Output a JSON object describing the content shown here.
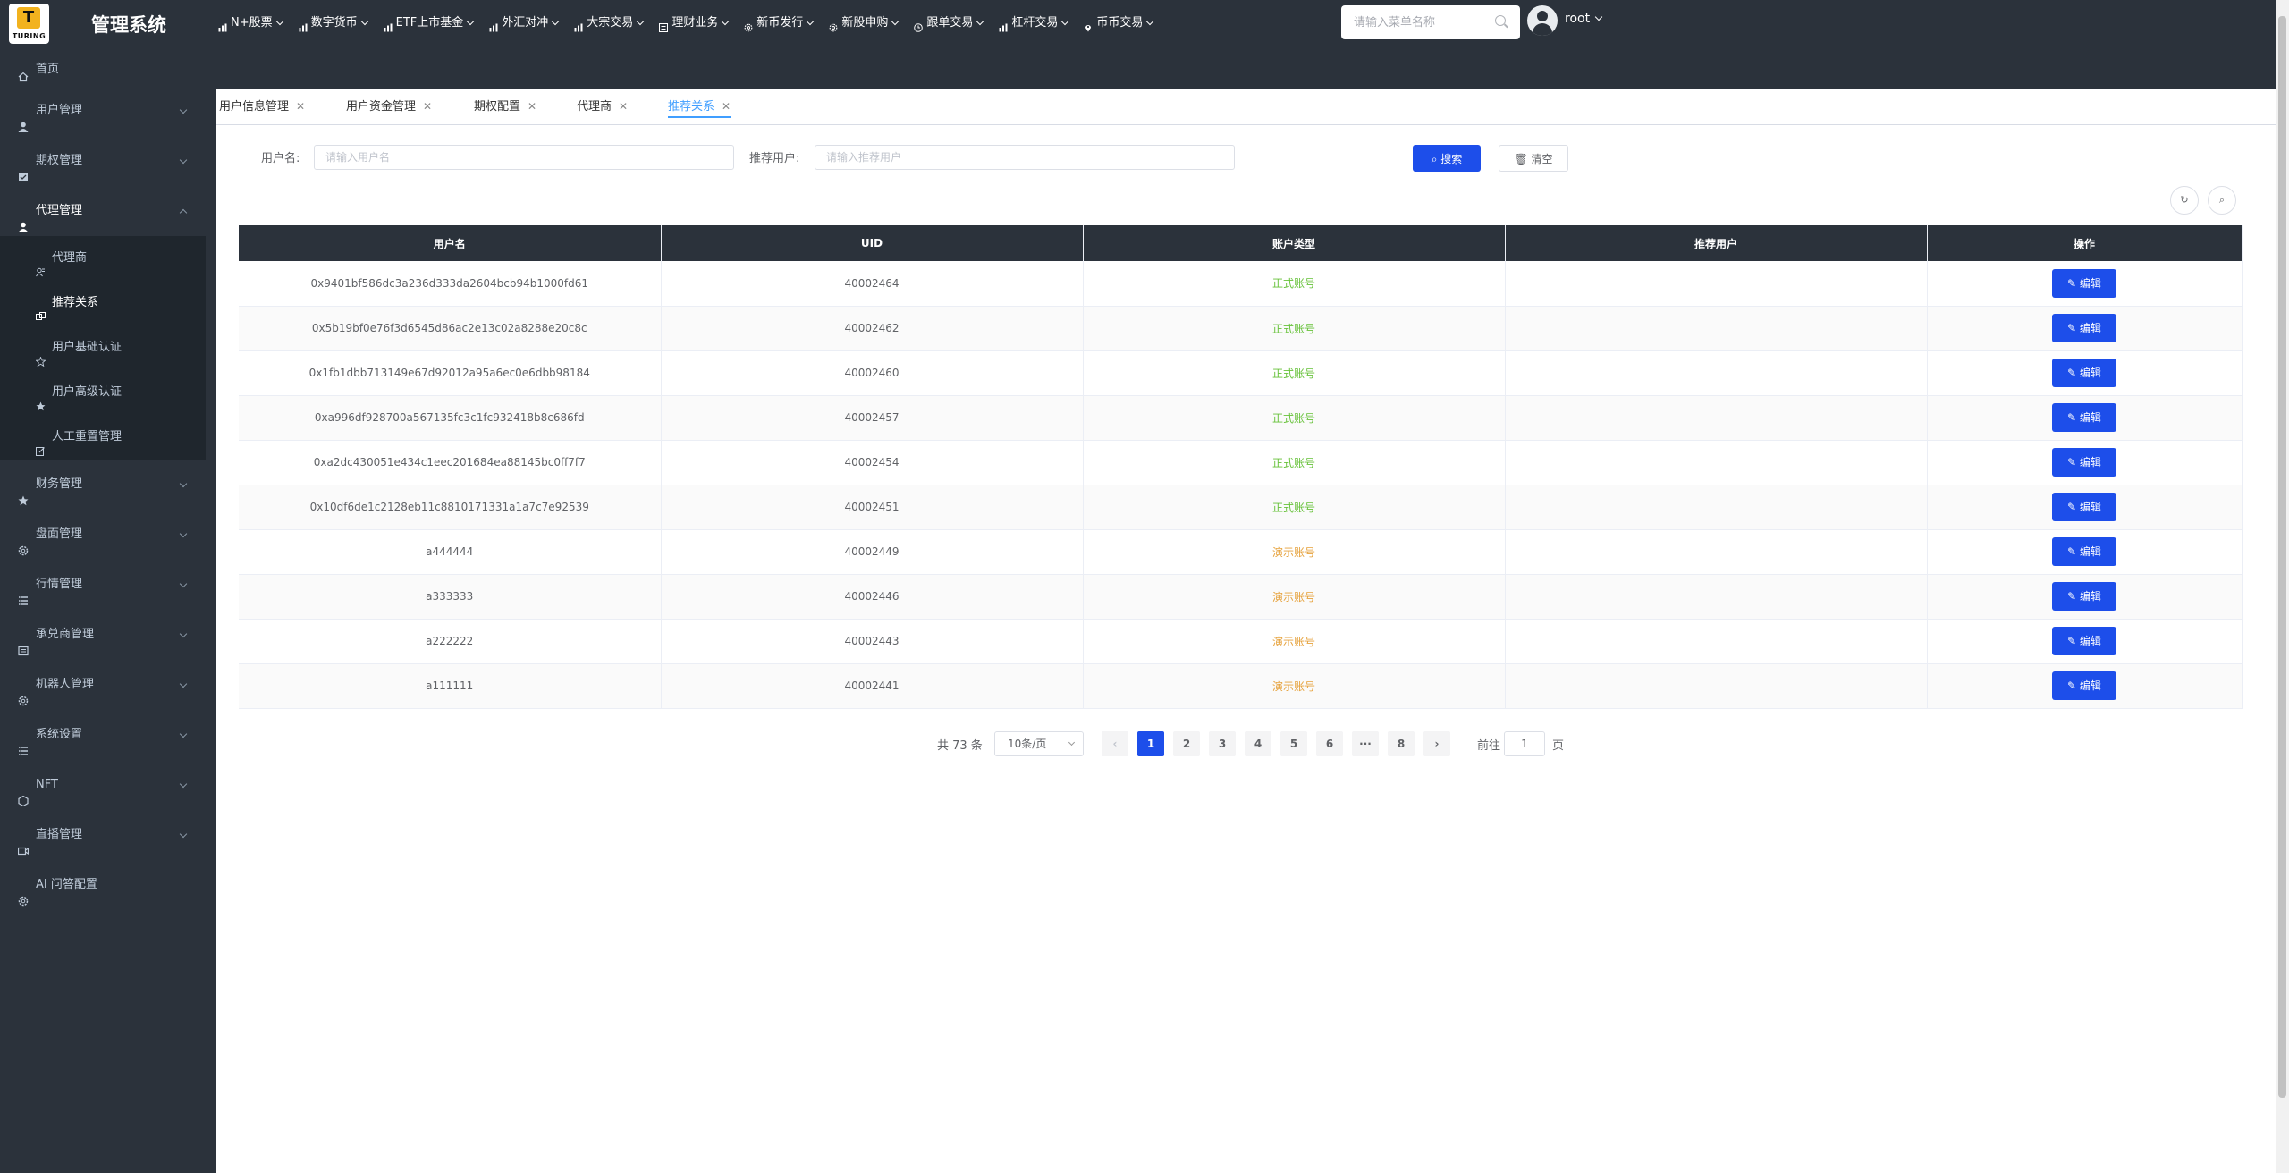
{
  "brand": {
    "logo_text": "TURING",
    "app_title": "管理系统"
  },
  "topnav": [
    {
      "label": "N+股票",
      "icon": "chart-bars-icon"
    },
    {
      "label": "数字货币",
      "icon": "chart-bars-icon"
    },
    {
      "label": "ETF上市基金",
      "icon": "chart-bars-icon"
    },
    {
      "label": "外汇对冲",
      "icon": "chart-bars-icon"
    },
    {
      "label": "大宗交易",
      "icon": "chart-bars-icon"
    },
    {
      "label": "理财业务",
      "icon": "list-icon"
    },
    {
      "label": "新币发行",
      "icon": "gear-icon"
    },
    {
      "label": "新股申购",
      "icon": "gear-icon"
    },
    {
      "label": "跟单交易",
      "icon": "clock-icon"
    },
    {
      "label": "杠杆交易",
      "icon": "chart-bars-icon"
    },
    {
      "label": "币币交易",
      "icon": "location-icon"
    }
  ],
  "header": {
    "search_placeholder": "请输入菜单名称",
    "user_name": "root"
  },
  "sidebar": {
    "items": [
      {
        "label": "首页",
        "icon": "home-icon"
      },
      {
        "label": "用户管理",
        "icon": "user-icon"
      },
      {
        "label": "期权管理",
        "icon": "checkbox-icon"
      },
      {
        "label": "代理管理",
        "icon": "user-icon"
      },
      {
        "label": "财务管理",
        "icon": "star-icon"
      },
      {
        "label": "盘面管理",
        "icon": "gear-icon"
      },
      {
        "label": "行情管理",
        "icon": "list-icon"
      },
      {
        "label": "承兑商管理",
        "icon": "box-icon"
      },
      {
        "label": "机器人管理",
        "icon": "gear-icon"
      },
      {
        "label": "系统设置",
        "icon": "list-icon"
      },
      {
        "label": "NFT",
        "icon": "nft-icon"
      },
      {
        "label": "直播管理",
        "icon": "video-icon"
      },
      {
        "label": "AI 问答配置",
        "icon": "gear-icon"
      }
    ],
    "subitems": [
      {
        "label": "代理商",
        "icon": "agent-icon"
      },
      {
        "label": "推荐关系",
        "icon": "link-icon"
      },
      {
        "label": "用户基础认证",
        "icon": "star-outline-icon"
      },
      {
        "label": "用户高级认证",
        "icon": "star-icon"
      },
      {
        "label": "人工重置管理",
        "icon": "edit-icon"
      }
    ]
  },
  "tabs": [
    {
      "label": "用户信息管理"
    },
    {
      "label": "用户资金管理"
    },
    {
      "label": "期权配置"
    },
    {
      "label": "代理商"
    },
    {
      "label": "推荐关系"
    }
  ],
  "filters": {
    "username_label": "用户名:",
    "username_placeholder": "请输入用户名",
    "referrer_label": "推荐用户:",
    "referrer_placeholder": "请输入推荐用户",
    "search_button": "搜索",
    "clear_button": "清空"
  },
  "table": {
    "columns": [
      "用户名",
      "UID",
      "账户类型",
      "推荐用户",
      "操作"
    ],
    "edit_label": "编辑",
    "rows": [
      {
        "username": "0x9401bf586dc3a236d333da2604bcb94b1000fd61",
        "uid": "40002464",
        "type": "正式账号",
        "type_kind": "real",
        "referrer": ""
      },
      {
        "username": "0x5b19bf0e76f3d6545d86ac2e13c02a8288e20c8c",
        "uid": "40002462",
        "type": "正式账号",
        "type_kind": "real",
        "referrer": ""
      },
      {
        "username": "0x1fb1dbb713149e67d92012a95a6ec0e6dbb98184",
        "uid": "40002460",
        "type": "正式账号",
        "type_kind": "real",
        "referrer": ""
      },
      {
        "username": "0xa996df928700a567135fc3c1fc932418b8c686fd",
        "uid": "40002457",
        "type": "正式账号",
        "type_kind": "real",
        "referrer": ""
      },
      {
        "username": "0xa2dc430051e434c1eec201684ea88145bc0ff7f7",
        "uid": "40002454",
        "type": "正式账号",
        "type_kind": "real",
        "referrer": ""
      },
      {
        "username": "0x10df6de1c2128eb11c8810171331a1a7c7e92539",
        "uid": "40002451",
        "type": "正式账号",
        "type_kind": "real",
        "referrer": ""
      },
      {
        "username": "a444444",
        "uid": "40002449",
        "type": "演示账号",
        "type_kind": "demo",
        "referrer": ""
      },
      {
        "username": "a333333",
        "uid": "40002446",
        "type": "演示账号",
        "type_kind": "demo",
        "referrer": ""
      },
      {
        "username": "a222222",
        "uid": "40002443",
        "type": "演示账号",
        "type_kind": "demo",
        "referrer": ""
      },
      {
        "username": "a111111",
        "uid": "40002441",
        "type": "演示账号",
        "type_kind": "demo",
        "referrer": ""
      }
    ]
  },
  "pagination": {
    "total": "共 73 条",
    "page_size": "10条/页",
    "pages": [
      "1",
      "2",
      "3",
      "4",
      "5",
      "6",
      "···",
      "8"
    ],
    "current": "1",
    "goto_label": "前往",
    "goto_value": "1",
    "page_suffix": "页"
  },
  "colors": {
    "primary": "#1d4eea",
    "header_bg": "#2b323b",
    "real": "#67c23a",
    "demo": "#e6a23c"
  }
}
